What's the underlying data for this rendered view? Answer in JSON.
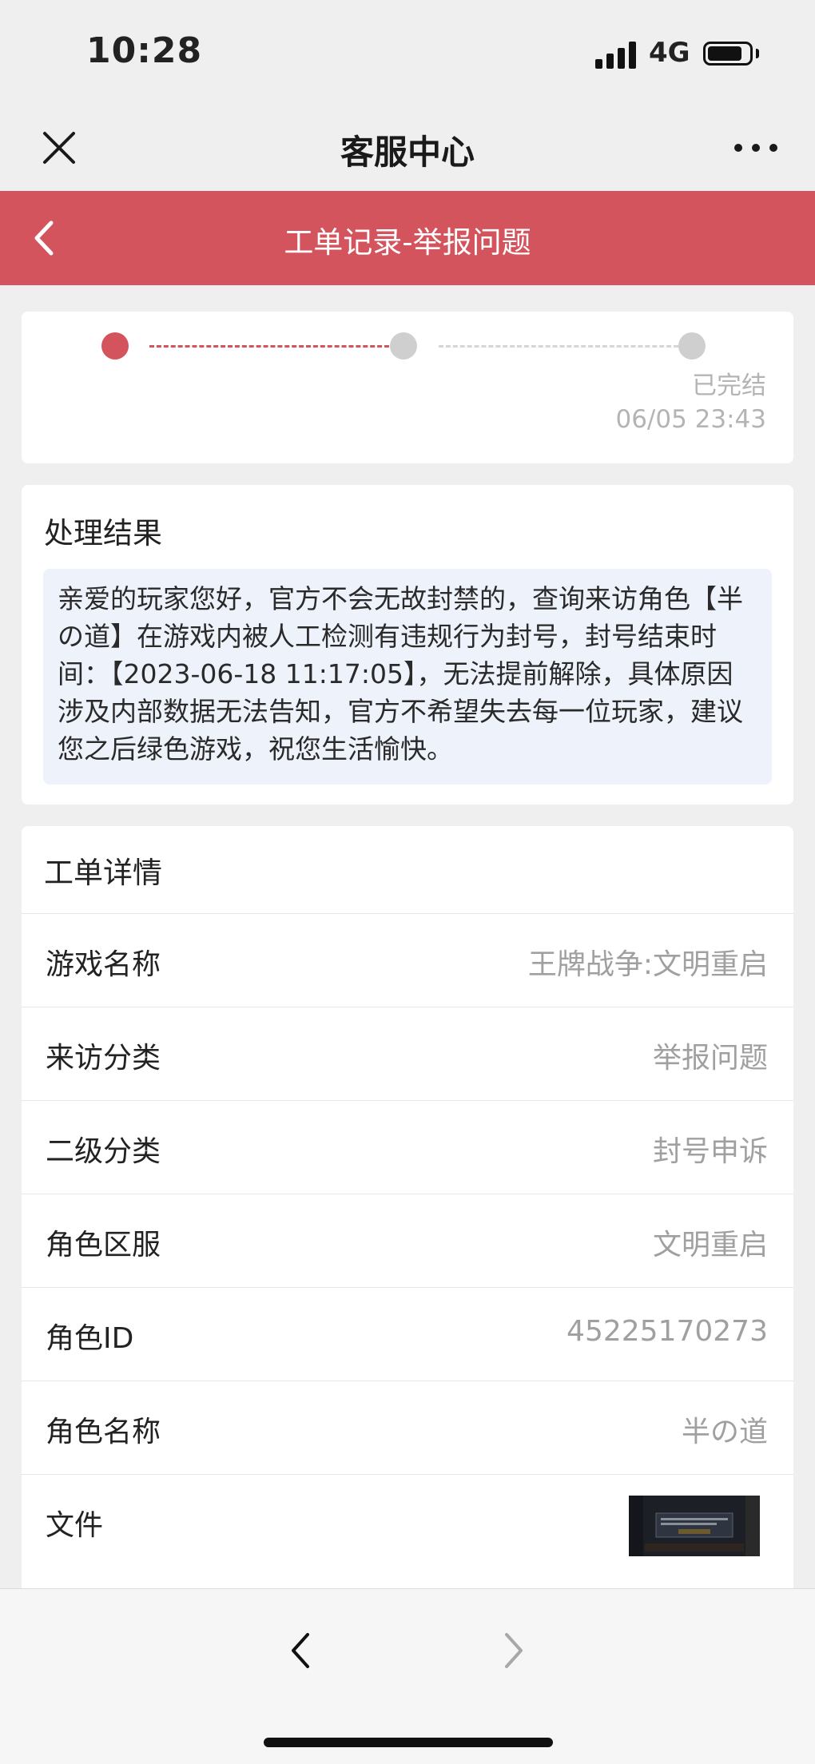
{
  "status_bar": {
    "time": "10:28",
    "network": "4G",
    "battery_level": 0.84
  },
  "title_bar": {
    "title": "客服中心",
    "close_icon": "close-icon",
    "more_icon": "more-dots-icon"
  },
  "header": {
    "title": "工单记录-举报问题",
    "back_icon": "chevron-left-icon",
    "color": "#d4545d"
  },
  "progress": {
    "steps_total": 3,
    "steps_active": 1,
    "final_label": "已完结",
    "final_time": "06/05 23:43",
    "active_color": "#d4545d",
    "inactive_color": "#cfcfcf"
  },
  "result": {
    "title": "处理结果",
    "text": "亲爱的玩家您好，官方不会无故封禁的，查询来访角色【半の道】在游戏内被人工检测有违规行为封号，封号结束时间：【2023-06-18 11:17:05】，无法提前解除，具体原因涉及内部数据无法告知，官方不希望失去每一位玩家，建议您之后绿色游戏，祝您生活愉快。"
  },
  "details": {
    "title": "工单详情",
    "rows": [
      {
        "label": "游戏名称",
        "value": "王牌战争:文明重启"
      },
      {
        "label": "来访分类",
        "value": "举报问题"
      },
      {
        "label": "二级分类",
        "value": "封号申诉"
      },
      {
        "label": "角色区服",
        "value": "文明重启"
      },
      {
        "label": "角色ID",
        "value": "45225170273"
      },
      {
        "label": "角色名称",
        "value": "半の道"
      },
      {
        "label": "文件",
        "value": ""
      }
    ]
  },
  "toolbar": {
    "back_icon": "chevron-left-icon",
    "forward_icon": "chevron-right-icon"
  }
}
